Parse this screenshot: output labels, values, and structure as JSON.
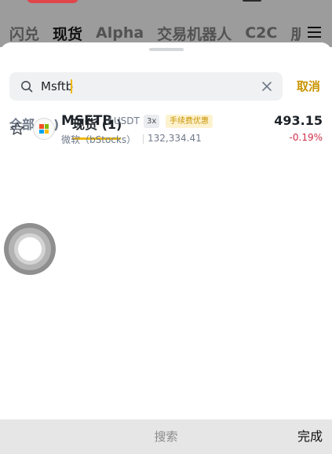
{
  "background": {
    "tabs": [
      {
        "label": "闪兑",
        "active": false
      },
      {
        "label": "现货",
        "active": true
      },
      {
        "label": "Alpha",
        "active": false
      },
      {
        "label": "交易机器人",
        "active": false
      },
      {
        "label": "C2C",
        "active": false
      },
      {
        "label": "朋",
        "active": false
      }
    ],
    "menu_icon": "hamburger-icon"
  },
  "search": {
    "value": "Msftb",
    "search_icon": "search-icon",
    "clear_icon": "close-icon",
    "cancel_label": "取消"
  },
  "filter_tabs": [
    {
      "label": "全部 (1)",
      "active": false
    },
    {
      "label": "现货 (1)",
      "active": true
    }
  ],
  "results": [
    {
      "symbol": "MSFTB",
      "quote": "/ USDT",
      "leverage": "3x",
      "badge": "手续费优惠",
      "name": "微软（bStocks）",
      "volume": "132,334.41",
      "price": "493.15",
      "change": "-0.19%",
      "change_color": "#cf304a",
      "favorite_icon": "star-outline-icon",
      "coin_icon": "microsoft-logo-icon"
    }
  ],
  "keyboard_bar": {
    "center_label": "搜索",
    "done_label": "完成"
  },
  "colors": {
    "accent": "#f0b90b",
    "accent_text": "#c99400",
    "negative": "#cf304a"
  }
}
